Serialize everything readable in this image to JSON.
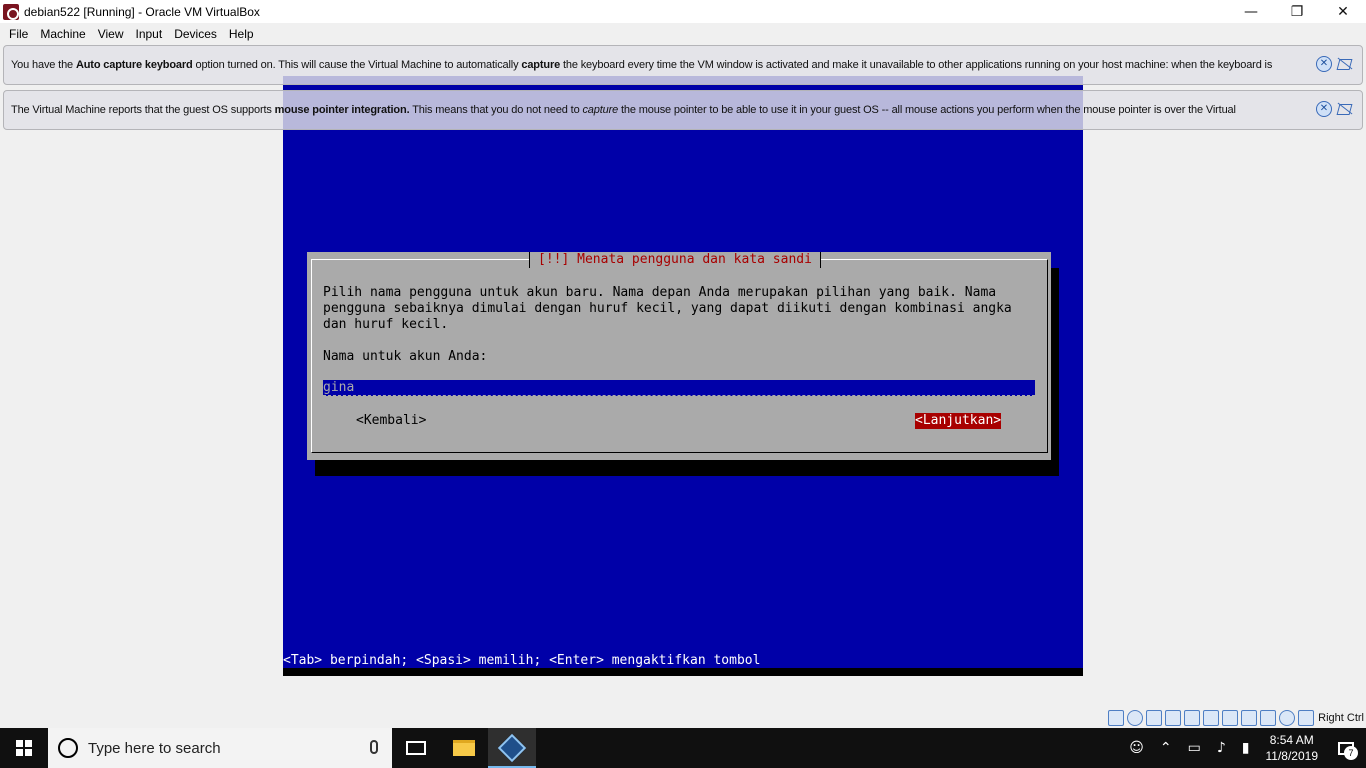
{
  "window": {
    "title": "debian522 [Running] - Oracle VM VirtualBox",
    "minimize": "—",
    "maximize": "❐",
    "close": "✕"
  },
  "menu": [
    "File",
    "Machine",
    "View",
    "Input",
    "Devices",
    "Help"
  ],
  "banners": {
    "keyboard": {
      "pre": "You have the ",
      "bold1": "Auto capture keyboard",
      "mid": " option turned on. This will cause the Virtual Machine to automatically ",
      "bold2": "capture",
      "post": " the keyboard every time the VM window is activated and make it unavailable to other applications running on your host machine: when the keyboard is"
    },
    "mouse": {
      "pre": "The Virtual Machine reports that the guest OS supports ",
      "bold1": "mouse pointer integration.",
      "mid": " This means that you do not need to ",
      "italic1": "capture",
      "post": " the mouse pointer to be able to use it in your guest OS -- all mouse actions you perform when the mouse pointer is over the Virtual"
    },
    "close_glyph": "✕"
  },
  "installer": {
    "title": "[!!] Menata pengguna dan kata sandi",
    "description": "Pilih nama pengguna untuk akun baru. Nama depan Anda merupakan pilihan yang baik. Nama\npengguna sebaiknya dimulai dengan huruf kecil, yang dapat diikuti dengan kombinasi angka\ndan huruf kecil.",
    "prompt": "Nama untuk akun Anda:",
    "input_value": "gina",
    "back_label": "<Kembali>",
    "next_label": "<Lanjutkan>",
    "status_line": "<Tab> berpindah; <Spasi> memilih; <Enter> mengaktifkan tombol",
    "colors": {
      "background": "#0000a8",
      "dialog": "#aaaaaa",
      "title": "#a80000",
      "selected": "#a80000"
    }
  },
  "vbox_status": {
    "host_key": "Right Ctrl"
  },
  "taskbar": {
    "search_placeholder": "Type here to search",
    "time": "8:54 AM",
    "date": "11/8/2019",
    "notification_count": "7"
  }
}
